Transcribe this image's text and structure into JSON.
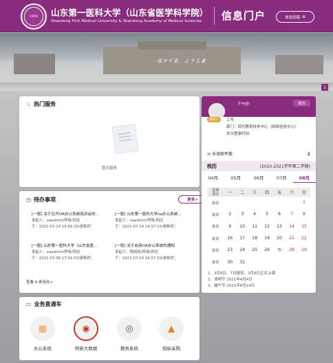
{
  "header": {
    "seal_text": "1890",
    "title_cn": "山东第一医科大学（山东省医学科学院）",
    "title_en": "Shandong First Medical University & Shandong Academy of Medical Sciences",
    "portal": "信息门户",
    "old_version_label": "体验旧版",
    "old_version_icon": "⊞"
  },
  "banner": {
    "slogan": "福步千里，止于至善",
    "page": "1"
  },
  "hot_services": {
    "title": "热门服务",
    "icon": "flame-icon",
    "empty_text": "暂无服务"
  },
  "todo": {
    "title": "待办事项",
    "more": "更多>",
    "items": [
      {
        "title": "[一般] 关于召开OA办公系统培训会的...",
        "from": "发起人：oaadmin/停用/到达",
        "time": "于：2021-07-14 16:56:25/是耗时："
      },
      {
        "title": "[一般] 山东第一医科大学oa办公系统...",
        "from": "发起人：oaadmin/停用/到达",
        "time": "于：2021-07-14 16:57:15/是耗时："
      },
      {
        "title": "[一般] 山东第一医科大学（山东省医...",
        "from": "发起人：oaadmin/停用/到达",
        "time": "于：2021-07-08 17:01:53/是耗时："
      },
      {
        "title": "[一般] 关于启用OA办公系统的通知",
        "from": "发起人：杨晓亮/停用/到达",
        "time": "于：2021-07-14 16:57:10/是耗时："
      }
    ],
    "summary": "查看 9 条待办>"
  },
  "biz": {
    "title": "业务直通车",
    "services": [
      {
        "label": "办公系统",
        "icon": "office-icon",
        "glyph": "▦",
        "color": "#e8a341"
      },
      {
        "label": "师新大数据",
        "icon": "bigdata-icon",
        "glyph": "◉",
        "color": "#c0392b"
      },
      {
        "label": "教务系统",
        "icon": "academic-icon",
        "glyph": "◎",
        "color": "#555555"
      },
      {
        "label": "招标采购",
        "icon": "procurement-icon",
        "glyph": "▲",
        "color": "#e67e22"
      }
    ]
  },
  "user": {
    "greeting": "下午好!",
    "logout": "退出",
    "badge": "教职工",
    "id_label": "工号:",
    "dept": "部门：现代教育技术中心（网络信息中心）",
    "last_login": "本次登录时间:",
    "mail_label": "未读邮件数",
    "mail_count": "2"
  },
  "calendar": {
    "title": "校历",
    "term": "(2020-2021学年第二学期)",
    "months": [
      "04月",
      "05月",
      "06月",
      "07月",
      "08月"
    ],
    "active_month": "08月",
    "week_header": "星期\n周次",
    "day_headers": [
      "一",
      "二",
      "三",
      "四",
      "五",
      "六",
      "日"
    ],
    "rows": [
      {
        "wk": "暑假",
        "days": [
          "",
          "",
          "",
          "",
          "",
          "",
          "1"
        ]
      },
      {
        "wk": "暑假",
        "days": [
          "2",
          "3",
          "4",
          "5",
          "6",
          "7",
          "8"
        ]
      },
      {
        "wk": "暑假",
        "days": [
          "9",
          "10",
          "11",
          "12",
          "13",
          "14",
          "15"
        ]
      },
      {
        "wk": "暑假",
        "days": [
          "16",
          "17",
          "18",
          "19",
          "20",
          "21",
          "22"
        ]
      },
      {
        "wk": "暑假",
        "days": [
          "23",
          "24",
          "25",
          "26",
          "今",
          "28",
          "29"
        ]
      },
      {
        "wk": "暑假",
        "days": [
          "30",
          "31",
          "",
          "",
          "",
          "",
          ""
        ]
      }
    ],
    "notes": [
      "1、3月6日、7日报到，3月8日正式上课",
      "2、清明节 2021年4月4日",
      "3、端午节 2021年6月14日"
    ]
  },
  "colors": {
    "brand": "#8a2c7e",
    "weekend": "#c23434",
    "mail": "#3a4f9b"
  }
}
